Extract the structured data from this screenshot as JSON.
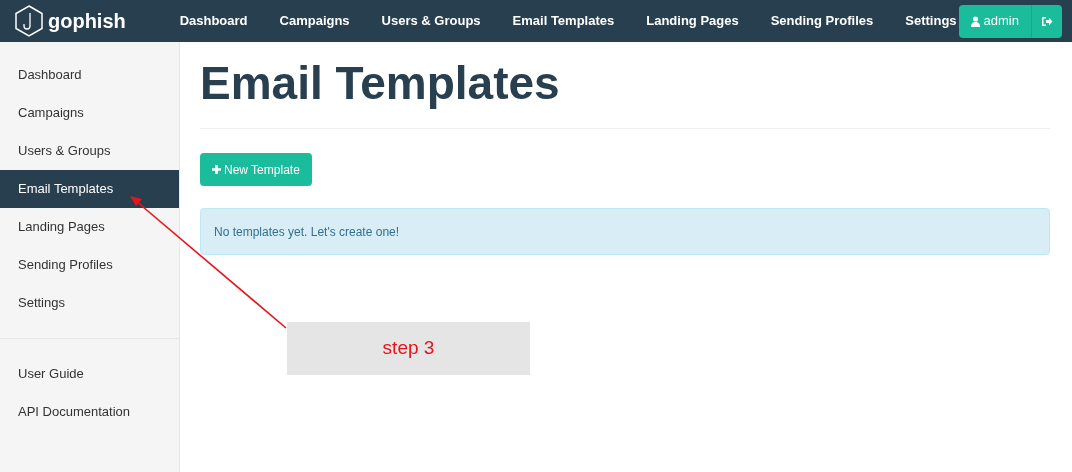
{
  "navbar": {
    "brand": "gophish",
    "links": [
      {
        "label": "Dashboard"
      },
      {
        "label": "Campaigns"
      },
      {
        "label": "Users & Groups"
      },
      {
        "label": "Email Templates"
      },
      {
        "label": "Landing Pages"
      },
      {
        "label": "Sending Profiles"
      },
      {
        "label": "Settings"
      }
    ],
    "user_button": "admin"
  },
  "sidebar": {
    "items": [
      {
        "label": "Dashboard",
        "selected": false
      },
      {
        "label": "Campaigns",
        "selected": false
      },
      {
        "label": "Users & Groups",
        "selected": false
      },
      {
        "label": "Email Templates",
        "selected": true
      },
      {
        "label": "Landing Pages",
        "selected": false
      },
      {
        "label": "Sending Profiles",
        "selected": false
      },
      {
        "label": "Settings",
        "selected": false
      }
    ],
    "help_items": [
      {
        "label": "User Guide"
      },
      {
        "label": "API Documentation"
      }
    ]
  },
  "page": {
    "title": "Email Templates",
    "new_button": "New Template",
    "alert": "No templates yet. Let's create one!"
  },
  "annotation": {
    "label": "step 3"
  }
}
